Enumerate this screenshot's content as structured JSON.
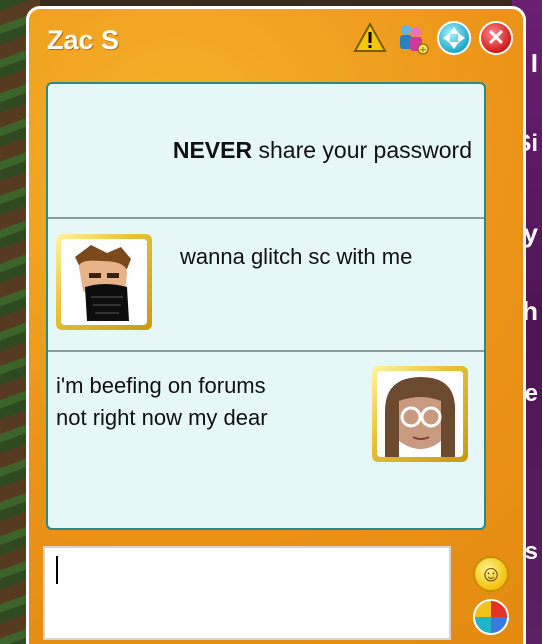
{
  "window": {
    "title": "Zac S"
  },
  "title_icons": [
    {
      "icon": "warning-icon"
    },
    {
      "icon": "add-friend-icon"
    },
    {
      "icon": "expand-icon"
    },
    {
      "icon": "close-icon"
    }
  ],
  "notice": {
    "bold": "NEVER",
    "rest": " share your password"
  },
  "messages": [
    {
      "text": "wanna glitch sc with me",
      "side": "left"
    },
    {
      "lines": [
        "i'm beefing on forums",
        "not right now my dear"
      ],
      "side": "right"
    }
  ],
  "input": {
    "value": ""
  },
  "side_glyphs": [
    "I",
    "Si",
    "y",
    "h",
    "le",
    "ys"
  ],
  "colors": {
    "frame": "#ec9418",
    "panel": "#e6f7f7",
    "border": "#2a8a8a"
  }
}
